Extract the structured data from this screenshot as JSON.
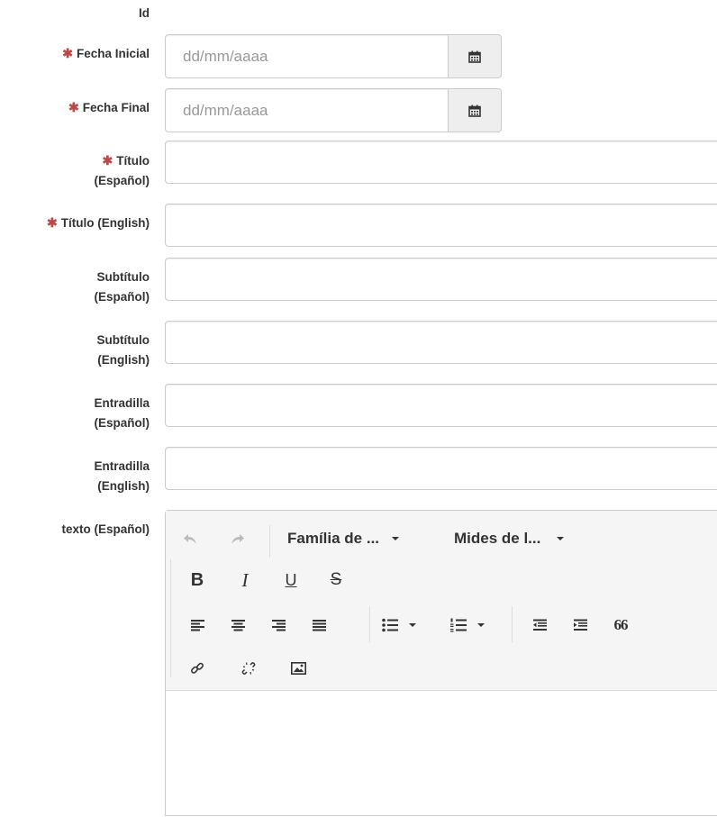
{
  "fields": {
    "id_label": "Id",
    "fecha_inicial": {
      "label": "Fecha Inicial",
      "placeholder": "dd/mm/aaaa"
    },
    "fecha_final": {
      "label": "Fecha Final",
      "placeholder": "dd/mm/aaaa"
    },
    "titulo_es": {
      "label_line1": "Título",
      "label_line2": "(Español)",
      "value": ""
    },
    "titulo_en": {
      "label": "Título (English)",
      "value": ""
    },
    "subtitulo_es": {
      "label_line1": "Subtítulo",
      "label_line2": "(Español)",
      "value": ""
    },
    "subtitulo_en": {
      "label_line1": "Subtítulo",
      "label_line2": "(English)",
      "value": ""
    },
    "entradilla_es": {
      "label_line1": "Entradilla",
      "label_line2": "(Español)",
      "value": ""
    },
    "entradilla_en": {
      "label_line1": "Entradilla",
      "label_line2": "(English)",
      "value": ""
    },
    "texto_es": {
      "label": "texto (Español)"
    }
  },
  "required_marker": "✱",
  "editor": {
    "font_family_label": "Família de ...",
    "font_size_label": "Mides de l...",
    "bold": "B",
    "italic": "I",
    "underline": "U",
    "strike": "S",
    "quote": "66",
    "icons": [
      "undo-icon",
      "redo-icon",
      "align-left-icon",
      "align-center-icon",
      "align-right-icon",
      "align-justify-icon",
      "bullet-list-icon",
      "numbered-list-icon",
      "outdent-icon",
      "indent-icon",
      "blockquote-icon",
      "link-icon",
      "unlink-icon",
      "image-icon",
      "calendar-icon"
    ]
  },
  "colors": {
    "required": "#b94a48",
    "border": "#cccccc",
    "addon_bg": "#eeeeee",
    "toolbar_bg": "#f5f5f5"
  }
}
